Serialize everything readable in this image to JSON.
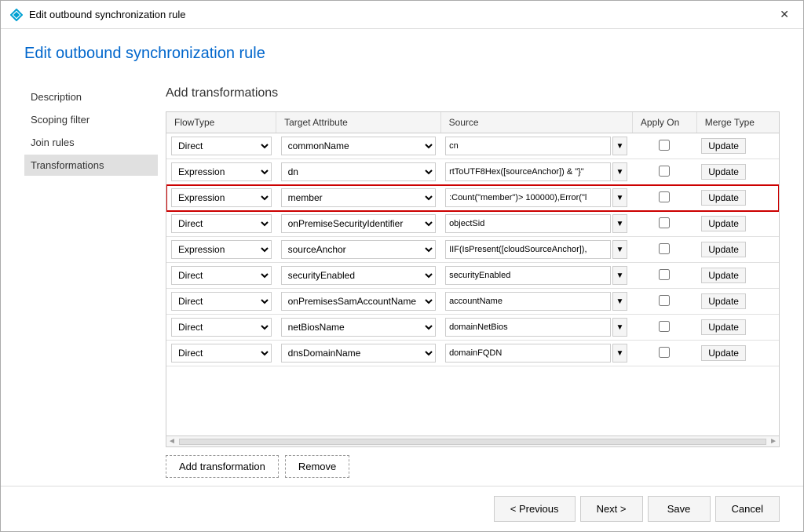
{
  "window": {
    "title": "Edit outbound synchronization rule",
    "close_label": "✕"
  },
  "page_header": {
    "title": "Edit outbound synchronization rule"
  },
  "sidebar": {
    "items": [
      {
        "label": "Description",
        "active": false
      },
      {
        "label": "Scoping filter",
        "active": false
      },
      {
        "label": "Join rules",
        "active": false
      },
      {
        "label": "Transformations",
        "active": true
      }
    ]
  },
  "main": {
    "section_title": "Add transformations",
    "table": {
      "headers": [
        "FlowType",
        "Target Attribute",
        "Source",
        "Apply On",
        "Merge Type"
      ],
      "rows": [
        {
          "flowType": "Direct",
          "targetAttr": "commonName",
          "source": "cn",
          "applyOn": false,
          "mergeType": "Update",
          "highlighted": false
        },
        {
          "flowType": "Expression",
          "targetAttr": "dn",
          "source": "rtToUTF8Hex([sourceAnchor]) & \"}\"",
          "applyOn": false,
          "mergeType": "Update",
          "highlighted": false
        },
        {
          "flowType": "Expression",
          "targetAttr": "member",
          "source": ":Count(\"member\")> 100000),Error(\"l",
          "applyOn": false,
          "mergeType": "Update",
          "highlighted": true
        },
        {
          "flowType": "Direct",
          "targetAttr": "onPremiseSecurityIdentifier",
          "source": "objectSid",
          "applyOn": false,
          "mergeType": "Update",
          "highlighted": false
        },
        {
          "flowType": "Expression",
          "targetAttr": "sourceAnchor",
          "source": "IIF(IsPresent([cloudSourceAnchor]),",
          "applyOn": false,
          "mergeType": "Update",
          "highlighted": false
        },
        {
          "flowType": "Direct",
          "targetAttr": "securityEnabled",
          "source": "securityEnabled",
          "applyOn": false,
          "mergeType": "Update",
          "highlighted": false
        },
        {
          "flowType": "Direct",
          "targetAttr": "onPremisesSamAccountName",
          "source": "accountName",
          "applyOn": false,
          "mergeType": "Update",
          "highlighted": false
        },
        {
          "flowType": "Direct",
          "targetAttr": "netBiosName",
          "source": "domainNetBios",
          "applyOn": false,
          "mergeType": "Update",
          "highlighted": false
        },
        {
          "flowType": "Direct",
          "targetAttr": "dnsDomainName",
          "source": "domainFQDN",
          "applyOn": false,
          "mergeType": "Update",
          "highlighted": false
        }
      ]
    },
    "buttons": {
      "add_transformation": "Add transformation",
      "remove": "Remove"
    }
  },
  "footer": {
    "previous": "< Previous",
    "next": "Next >",
    "save": "Save",
    "cancel": "Cancel"
  }
}
